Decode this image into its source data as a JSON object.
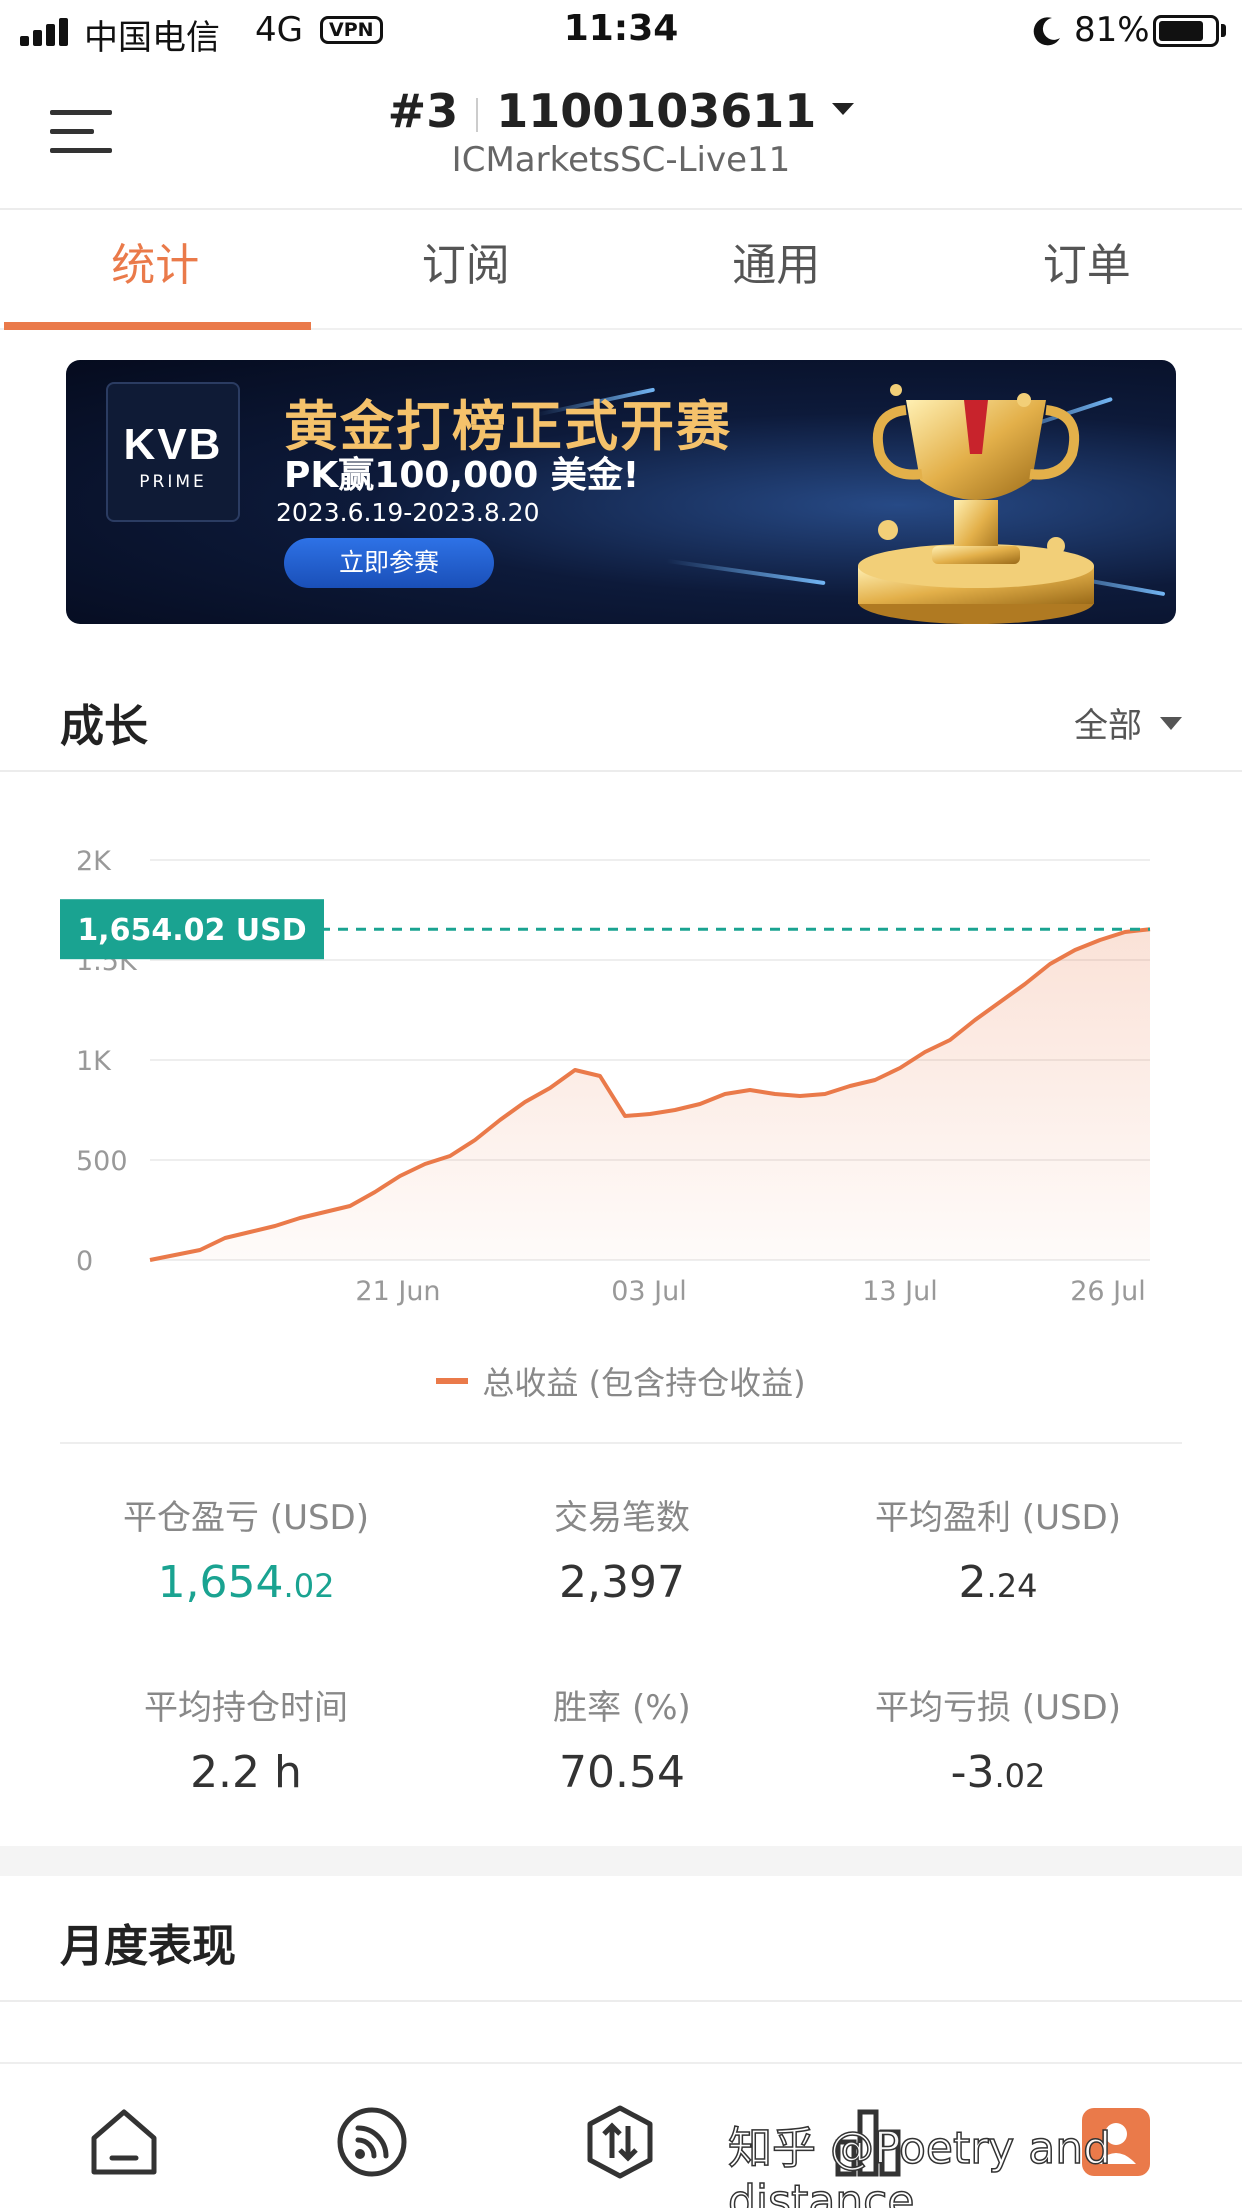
{
  "status_bar": {
    "carrier": "中国电信",
    "network": "4G",
    "vpn": "VPN",
    "time": "11:34",
    "battery_pct": "81%",
    "battery_level": 0.81
  },
  "header": {
    "account_index": "#3",
    "account_number": "1100103611",
    "server": "ICMarketsSC-Live11"
  },
  "tabs": [
    {
      "label": "统计",
      "active": true
    },
    {
      "label": "订阅",
      "active": false
    },
    {
      "label": "通用",
      "active": false
    },
    {
      "label": "订单",
      "active": false
    }
  ],
  "banner": {
    "logo_main": "KVB",
    "logo_sub": "PRIME",
    "title": "黄金打榜正式开赛",
    "subtitle": "PK赢100,000 美金!",
    "dates": "2023.6.19-2023.8.20",
    "button": "立即参赛"
  },
  "growth": {
    "title": "成长",
    "filter": "全部",
    "current_value_label": "1,654.02 USD",
    "legend": "总收益 (包含持仓收益)"
  },
  "chart_data": {
    "type": "area",
    "y_ticks": [
      "0",
      "500",
      "1K",
      "1.5K",
      "2K"
    ],
    "x_ticks": [
      "21 Jun",
      "03 Jul",
      "13 Jul",
      "26 Jul"
    ],
    "ylim": [
      0,
      2000
    ],
    "current_value": 1654.02,
    "line_color": "#ea7a4a",
    "series": [
      {
        "name": "总收益 (包含持仓收益)",
        "values": [
          0,
          25,
          50,
          110,
          140,
          170,
          210,
          240,
          270,
          340,
          420,
          480,
          520,
          600,
          700,
          790,
          860,
          950,
          920,
          720,
          730,
          750,
          780,
          830,
          850,
          830,
          820,
          830,
          870,
          900,
          960,
          1040,
          1100,
          1200,
          1290,
          1380,
          1480,
          1550,
          1600,
          1640,
          1654.02
        ]
      }
    ]
  },
  "stats": [
    {
      "label": "平仓盈亏 (USD)",
      "int": "1,654",
      "dec": ".02",
      "highlight": true
    },
    {
      "label": "交易笔数",
      "int": "2,397",
      "dec": "",
      "highlight": false
    },
    {
      "label": "平均盈利 (USD)",
      "int": "2",
      "dec": ".24",
      "highlight": false
    },
    {
      "label": "平均持仓时间",
      "int": "2.2 h",
      "dec": "",
      "highlight": false
    },
    {
      "label": "胜率 (%)",
      "int": "70.54",
      "dec": "",
      "highlight": false
    },
    {
      "label": "平均亏损 (USD)",
      "int": "-3",
      "dec": ".02",
      "highlight": false
    }
  ],
  "monthly": {
    "title": "月度表现"
  },
  "bottom_nav": [
    {
      "icon": "home-icon"
    },
    {
      "icon": "signal-icon"
    },
    {
      "icon": "trade-icon"
    },
    {
      "icon": "chart-icon"
    },
    {
      "icon": "profile-icon"
    }
  ],
  "watermark": "知乎 @Poetry and distance",
  "colors": {
    "accent": "#ea7a4a",
    "profit": "#1aa391"
  }
}
